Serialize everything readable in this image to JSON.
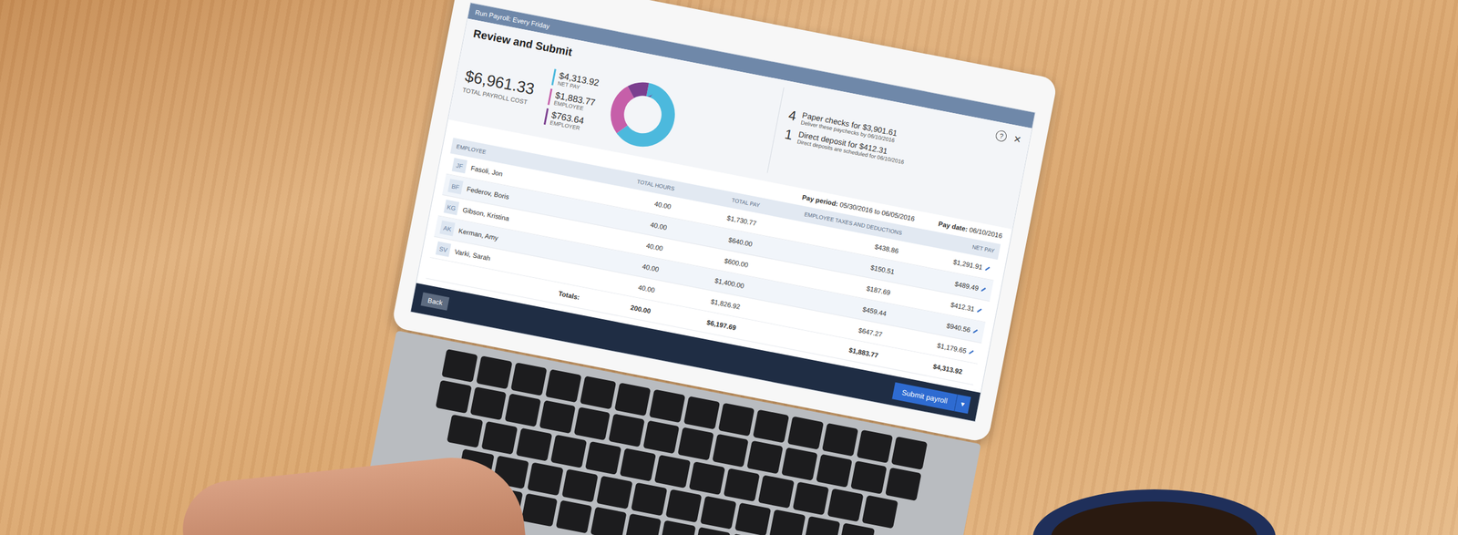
{
  "window": {
    "title": "Run Payroll: Every Friday",
    "help": "?",
    "close": "×"
  },
  "heading": "Review and Submit",
  "summary": {
    "total": "$6,961.33",
    "total_label": "TOTAL PAYROLL COST",
    "breakdown": [
      {
        "amount": "$4,313.92",
        "label": "NET PAY",
        "value": 4313.92,
        "color": "#4cb9dd"
      },
      {
        "amount": "$1,883.77",
        "label": "EMPLOYEE",
        "value": 1883.77,
        "color": "#c65fa9"
      },
      {
        "amount": "$763.64",
        "label": "EMPLOYER",
        "value": 763.64,
        "color": "#7b3f8f"
      }
    ]
  },
  "payments": [
    {
      "count": "4",
      "title": "Paper checks for $3,901.61",
      "note": "Deliver these paychecks by 06/10/2016"
    },
    {
      "count": "1",
      "title": "Direct deposit for $412.31",
      "note": "Direct deposits are scheduled for 06/10/2016"
    }
  ],
  "pay_period": {
    "label": "Pay period:",
    "value": "05/30/2016 to 06/05/2016"
  },
  "pay_date": {
    "label": "Pay date:",
    "value": "06/10/2016"
  },
  "table": {
    "columns": [
      "EMPLOYEE",
      "TOTAL HOURS",
      "TOTAL PAY",
      "EMPLOYEE TAXES AND DEDUCTIONS",
      "NET PAY"
    ],
    "rows": [
      {
        "initials": "JF",
        "name": "Fasoli, Jon",
        "hours": "40.00",
        "pay": "$1,730.77",
        "taxes": "$438.86",
        "net": "$1,291.91",
        "editable": true
      },
      {
        "initials": "BF",
        "name": "Federov, Boris",
        "hours": "40.00",
        "pay": "$640.00",
        "taxes": "$150.51",
        "net": "$489.49",
        "editable": true
      },
      {
        "initials": "KG",
        "name": "Gibson, Kristina",
        "hours": "40.00",
        "pay": "$600.00",
        "taxes": "$187.69",
        "net": "$412.31",
        "editable": true
      },
      {
        "initials": "AK",
        "name": "Kerman, Amy",
        "hours": "40.00",
        "pay": "$1,400.00",
        "taxes": "$459.44",
        "net": "$940.56",
        "editable": true
      },
      {
        "initials": "SV",
        "name": "Varki, Sarah",
        "hours": "40.00",
        "pay": "$1,826.92",
        "taxes": "$647.27",
        "net": "$1,179.65",
        "editable": true
      }
    ],
    "totals": {
      "label": "Totals:",
      "hours": "200.00",
      "pay": "$6,197.69",
      "taxes": "$1,883.77",
      "net": "$4,313.92"
    }
  },
  "buttons": {
    "back": "Back",
    "submit": "Submit payroll",
    "menu": "▾"
  }
}
